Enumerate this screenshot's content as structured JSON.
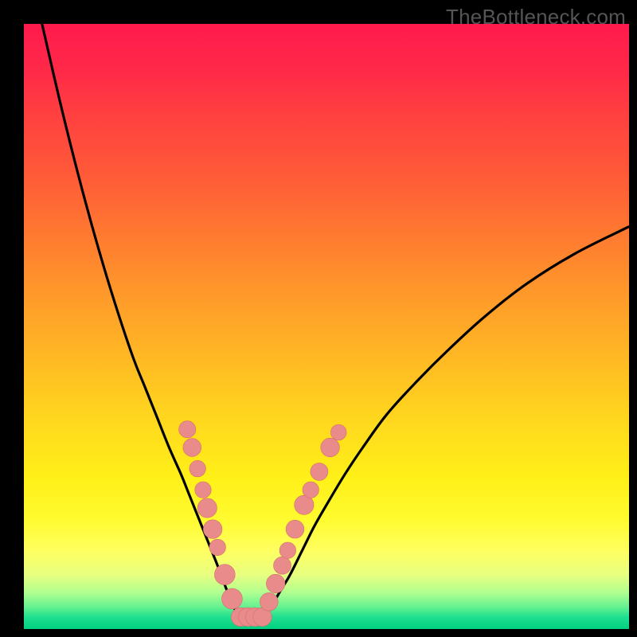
{
  "watermark": "TheBottleneck.com",
  "chart_data": {
    "type": "line",
    "title": "",
    "xlabel": "",
    "ylabel": "",
    "xlim": [
      0,
      100
    ],
    "ylim": [
      0,
      100
    ],
    "grid": false,
    "legend": false,
    "series": [
      {
        "name": "left-curve",
        "x": [
          3,
          6,
          9,
          12,
          15,
          18,
          20,
          22,
          24,
          26,
          27,
          28,
          29,
          30,
          31,
          32,
          33.5,
          34.5,
          35.5
        ],
        "y": [
          100,
          87,
          75,
          64,
          54,
          45,
          40,
          35,
          30,
          25.5,
          23,
          20.5,
          18,
          15.5,
          13,
          10.5,
          6.5,
          4,
          2
        ]
      },
      {
        "name": "right-curve",
        "x": [
          39.5,
          41,
          42.5,
          44,
          46,
          48,
          50,
          53,
          56,
          60,
          65,
          70,
          76,
          83,
          91,
          100
        ],
        "y": [
          2,
          4,
          6.5,
          9,
          13,
          17,
          20.5,
          25.5,
          30,
          35.5,
          41,
          46,
          51.5,
          57,
          62,
          66.5
        ]
      },
      {
        "name": "bottom-flat",
        "x": [
          35.5,
          36.5,
          37.5,
          38.5,
          39.5
        ],
        "y": [
          2,
          2,
          2,
          2,
          2
        ]
      }
    ],
    "markers": [
      {
        "side": "left",
        "x": 27.0,
        "y": 33.0,
        "r": 1.4
      },
      {
        "side": "left",
        "x": 27.8,
        "y": 30.0,
        "r": 1.5
      },
      {
        "side": "left",
        "x": 28.7,
        "y": 26.5,
        "r": 1.35
      },
      {
        "side": "left",
        "x": 29.6,
        "y": 23.0,
        "r": 1.35
      },
      {
        "side": "left",
        "x": 30.3,
        "y": 20.0,
        "r": 1.6
      },
      {
        "side": "left",
        "x": 31.2,
        "y": 16.5,
        "r": 1.55
      },
      {
        "side": "left",
        "x": 32.0,
        "y": 13.5,
        "r": 1.35
      },
      {
        "side": "left",
        "x": 33.2,
        "y": 9.0,
        "r": 1.7
      },
      {
        "side": "left",
        "x": 34.4,
        "y": 5.0,
        "r": 1.7
      },
      {
        "side": "bottom",
        "x": 35.8,
        "y": 2.0,
        "r": 1.55
      },
      {
        "side": "bottom",
        "x": 37.0,
        "y": 2.0,
        "r": 1.55
      },
      {
        "side": "bottom",
        "x": 38.2,
        "y": 2.0,
        "r": 1.55
      },
      {
        "side": "bottom",
        "x": 39.4,
        "y": 2.0,
        "r": 1.55
      },
      {
        "side": "right",
        "x": 40.5,
        "y": 4.5,
        "r": 1.5
      },
      {
        "side": "right",
        "x": 41.6,
        "y": 7.5,
        "r": 1.55
      },
      {
        "side": "right",
        "x": 42.7,
        "y": 10.5,
        "r": 1.45
      },
      {
        "side": "right",
        "x": 43.6,
        "y": 13.0,
        "r": 1.35
      },
      {
        "side": "right",
        "x": 44.8,
        "y": 16.5,
        "r": 1.5
      },
      {
        "side": "right",
        "x": 46.3,
        "y": 20.5,
        "r": 1.6
      },
      {
        "side": "right",
        "x": 47.4,
        "y": 23.0,
        "r": 1.35
      },
      {
        "side": "right",
        "x": 48.8,
        "y": 26.0,
        "r": 1.45
      },
      {
        "side": "right",
        "x": 50.6,
        "y": 30.0,
        "r": 1.55
      },
      {
        "side": "right",
        "x": 52.0,
        "y": 32.5,
        "r": 1.3
      }
    ],
    "colors": {
      "curve": "#000000",
      "marker_fill": "#e98b8b",
      "marker_stroke": "#d46e6e"
    }
  }
}
